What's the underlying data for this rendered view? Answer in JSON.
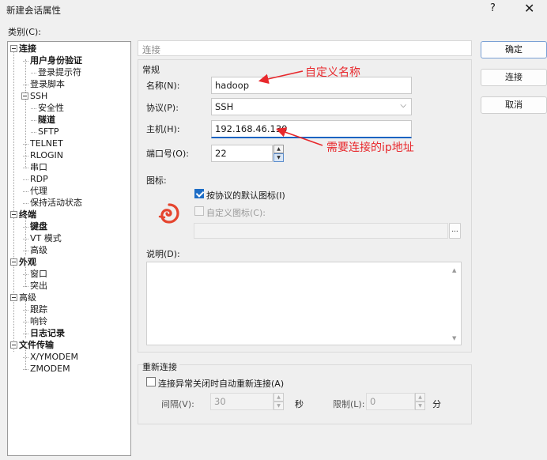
{
  "window": {
    "title": "新建会话属性",
    "help": "?",
    "close": "✕"
  },
  "category_label": "类别(C):",
  "tree": [
    {
      "label": "连接",
      "bold": true
    },
    {
      "label": "用户身份验证",
      "bold": true
    },
    {
      "label": "登录提示符",
      "bold": false
    },
    {
      "label": "登录脚本",
      "bold": false
    },
    {
      "label": "SSH",
      "bold": false
    },
    {
      "label": "安全性",
      "bold": false
    },
    {
      "label": "隧道",
      "bold": true
    },
    {
      "label": "SFTP",
      "bold": false
    },
    {
      "label": "TELNET",
      "bold": false
    },
    {
      "label": "RLOGIN",
      "bold": false
    },
    {
      "label": "串口",
      "bold": false
    },
    {
      "label": "RDP",
      "bold": false
    },
    {
      "label": "代理",
      "bold": false
    },
    {
      "label": "保持活动状态",
      "bold": false
    },
    {
      "label": "终端",
      "bold": true
    },
    {
      "label": "键盘",
      "bold": true
    },
    {
      "label": "VT 模式",
      "bold": false
    },
    {
      "label": "高级",
      "bold": false
    },
    {
      "label": "外观",
      "bold": true
    },
    {
      "label": "窗口",
      "bold": false
    },
    {
      "label": "突出",
      "bold": false
    },
    {
      "label": "高级",
      "bold": false
    },
    {
      "label": "跟踪",
      "bold": false
    },
    {
      "label": "响铃",
      "bold": false
    },
    {
      "label": "日志记录",
      "bold": true
    },
    {
      "label": "文件传输",
      "bold": true
    },
    {
      "label": "X/YMODEM",
      "bold": false
    },
    {
      "label": "ZMODEM",
      "bold": false
    }
  ],
  "section_header": "连接",
  "general": {
    "title": "常规",
    "name_label": "名称(N):",
    "name_value": "hadoop",
    "protocol_label": "协议(P):",
    "protocol_value": "SSH",
    "host_label": "主机(H):",
    "host_value": "192.168.46.130",
    "port_label": "端口号(O):",
    "port_value": "22",
    "icon_label": "图标:",
    "icon_default_label": "按协议的默认图标(I)",
    "icon_default_checked": true,
    "icon_custom_label": "自定义图标(C):",
    "icon_custom_checked": false,
    "browse_label": "...",
    "desc_label": "说明(D):"
  },
  "reconnect": {
    "title": "重新连接",
    "auto_label": "连接异常关闭时自动重新连接(A)",
    "auto_checked": false,
    "interval_label": "间隔(V):",
    "interval_value": "30",
    "seconds_unit": "秒",
    "limit_label": "限制(L):",
    "limit_value": "0",
    "minutes_unit": "分"
  },
  "buttons": {
    "ok": "确定",
    "connect": "连接",
    "cancel": "取消"
  },
  "annotations": {
    "name_note": "自定义名称",
    "host_note": "需要连接的ip地址"
  },
  "colors": {
    "annotation": "#e8282c",
    "accent": "#1d6dc6",
    "logo": "#e5452f"
  }
}
